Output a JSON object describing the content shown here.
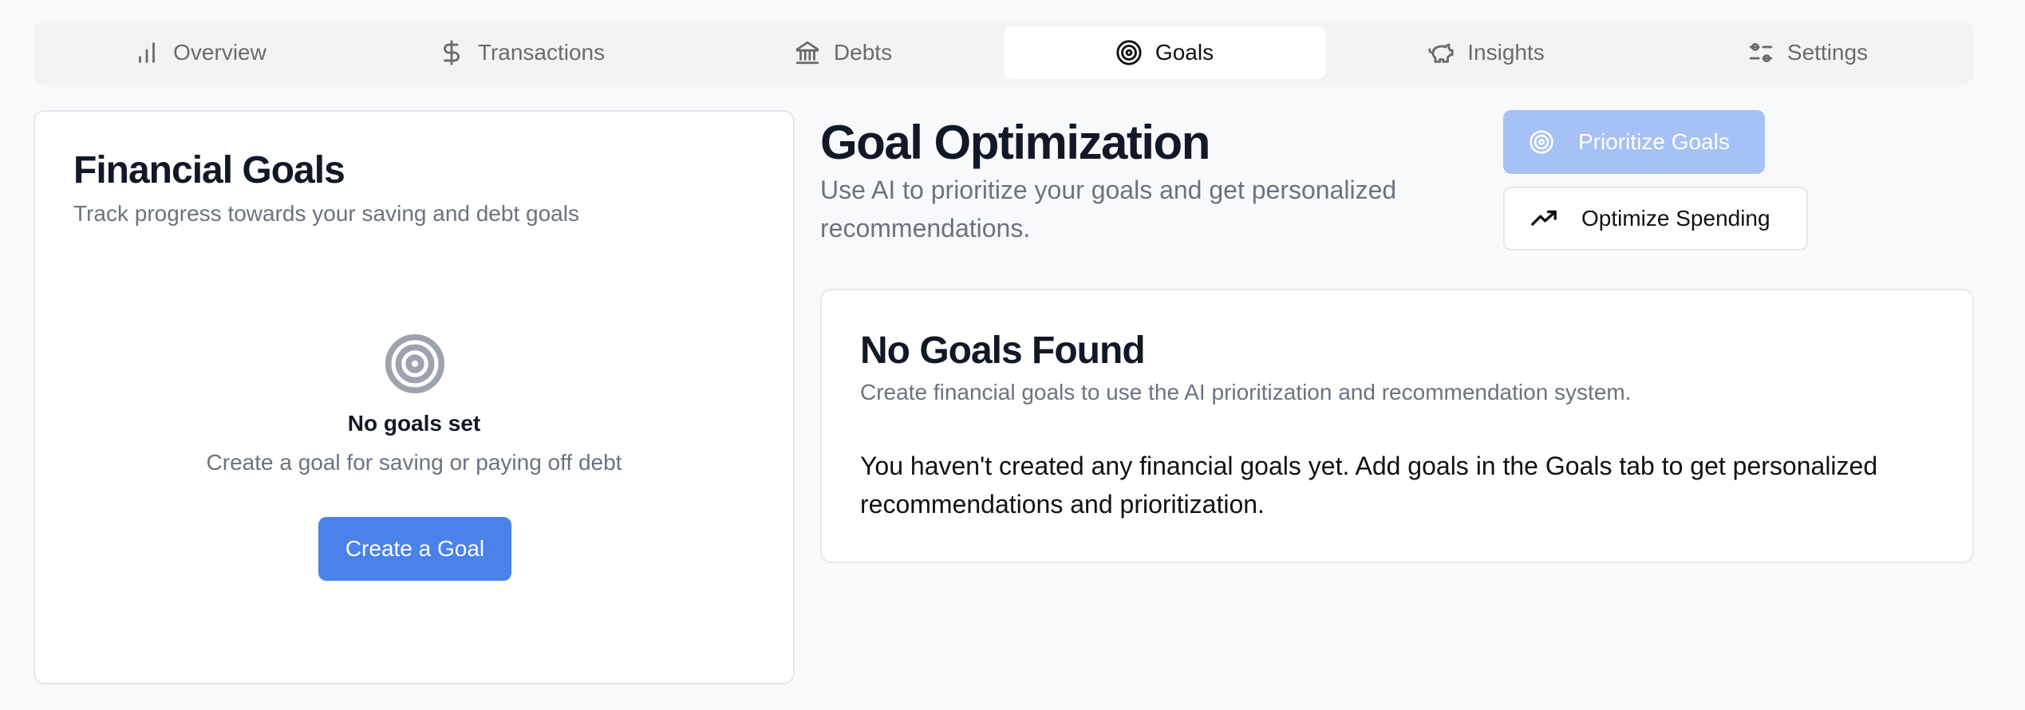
{
  "tabs": [
    {
      "label": "Overview",
      "icon": "bar-chart-icon",
      "active": false
    },
    {
      "label": "Transactions",
      "icon": "dollar-icon",
      "active": false
    },
    {
      "label": "Debts",
      "icon": "bank-icon",
      "active": false
    },
    {
      "label": "Goals",
      "icon": "target-icon",
      "active": true
    },
    {
      "label": "Insights",
      "icon": "piggy-bank-icon",
      "active": false
    },
    {
      "label": "Settings",
      "icon": "sliders-icon",
      "active": false
    }
  ],
  "financial_goals": {
    "title": "Financial Goals",
    "subtitle": "Track progress towards your saving and debt goals",
    "empty_title": "No goals set",
    "empty_subtitle": "Create a goal for saving or paying off debt",
    "create_button": "Create a Goal"
  },
  "optimization": {
    "title": "Goal Optimization",
    "description": "Use AI to prioritize your goals and get personalized recommendations.",
    "prioritize_button": "Prioritize Goals",
    "optimize_button": "Optimize Spending"
  },
  "no_goals_card": {
    "title": "No Goals Found",
    "subtitle": "Create financial goals to use the AI prioritization and recommendation system.",
    "body": "You haven't created any financial goals yet. Add goals in the Goals tab to get personalized recommendations and prioritization."
  },
  "colors": {
    "accent": "#4a82ea",
    "accent_disabled": "#a6c1f6",
    "muted_text": "#6b7280",
    "background": "#f8f9fb"
  }
}
